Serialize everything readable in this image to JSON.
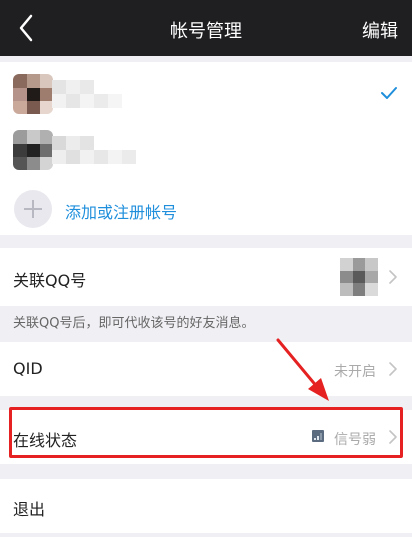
{
  "nav": {
    "title": "帐号管理",
    "edit_label": "编辑"
  },
  "accounts": {
    "add_label": "添加或注册帐号"
  },
  "linked_qq": {
    "label": "关联QQ号",
    "hint": "关联QQ号后，即可代收该号的好友消息。"
  },
  "qid": {
    "label": "QID",
    "value": "未开启"
  },
  "online_status": {
    "label": "在线状态",
    "value": "信号弱"
  },
  "logout": {
    "label": "退出"
  },
  "colors": {
    "nav_bg": "#1f1f22",
    "accent": "#1f8fdc",
    "highlight": "#e52121"
  },
  "icons": [
    "back-arrow-icon",
    "check-icon",
    "plus-icon",
    "chevron-right-icon",
    "signal-icon"
  ]
}
